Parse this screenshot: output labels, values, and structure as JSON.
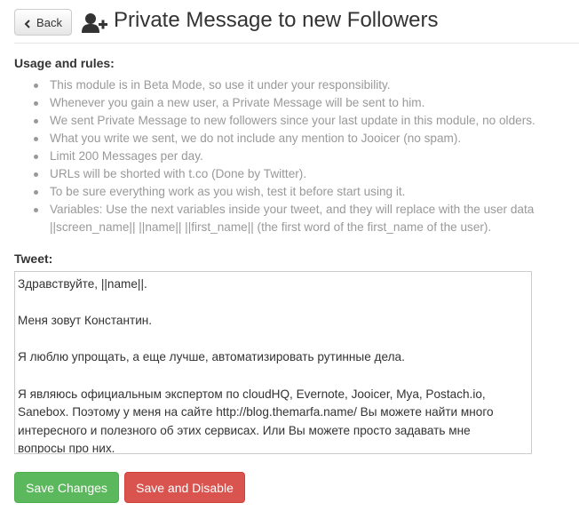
{
  "header": {
    "back_label": "Back",
    "back_icon": "chevron-left-icon",
    "title_icon": "add-user-icon",
    "title": "Private Message to new Followers"
  },
  "rules": {
    "heading": "Usage and rules:",
    "items": [
      "This module is in Beta Mode, so use it under your responsibility.",
      "Whenever you gain a new user, a Private Message will be sent to him.",
      "We sent Private Message to new followers since your last update in this module, no olders.",
      "What you write we sent, we do not include any mention to Jooicer (no spam).",
      "Limit 200 Messages per day.",
      "URLs will be shorted with t.co (Done by Twitter).",
      "To be sure everything work as you wish, test it before start using it."
    ],
    "variables_line1": "Variables: Use the next variables inside your tweet, and they will replace with the user data",
    "variables_line2": "||screen_name|| ||name|| ||first_name|| (the first word of the first_name of the user)."
  },
  "tweet": {
    "label": "Tweet:",
    "lines": [
      "Здравствуйте, ||name||.",
      "",
      "Меня зовут Константин.",
      "",
      "Я люблю упрощать, а еще лучше, автоматизировать рутинные дела.",
      "",
      "Я являюсь официальным экспертом по cloudHQ, Evernote, Jooicer, Mya, Postach.io,",
      "Sanebox. Поэтому у меня на сайте http://blog.themarfa.name/ Вы можете найти много",
      "интересного и полезного об этих сервисах. Или Вы можете просто задавать мне",
      "вопросы про них."
    ]
  },
  "actions": {
    "save_label": "Save Changes",
    "disable_label": "Save and Disable"
  },
  "colors": {
    "save": "#5cb85c",
    "disable": "#d9534f",
    "muted_text": "#999999"
  }
}
